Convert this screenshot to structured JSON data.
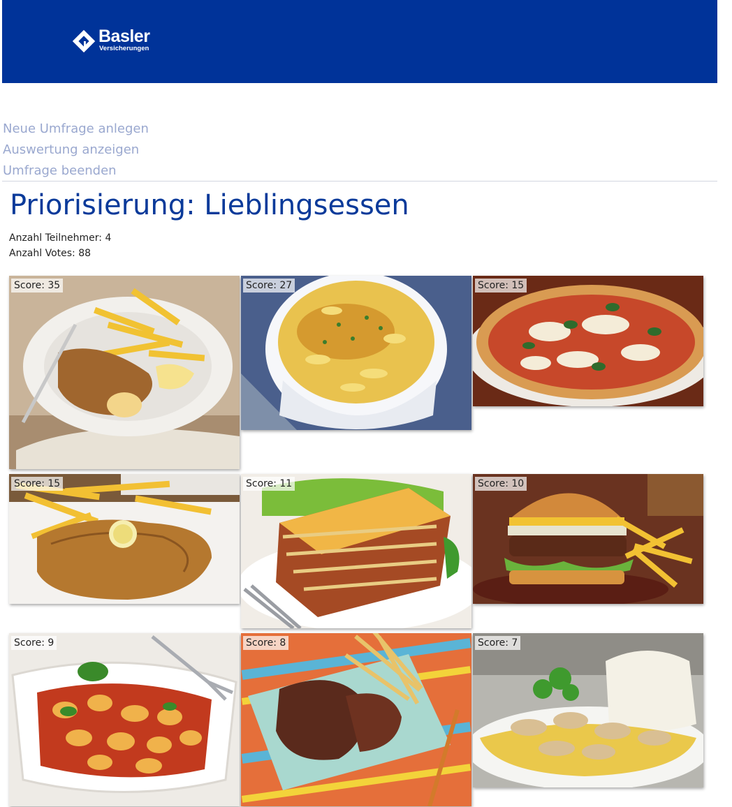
{
  "header": {
    "brand": "Basler",
    "brand_sub": "Versicherungen",
    "background_color": "#003399"
  },
  "nav": [
    {
      "label": "Neue Umfrage anlegen"
    },
    {
      "label": "Auswertung anzeigen"
    },
    {
      "label": "Umfrage beenden"
    }
  ],
  "page": {
    "title": "Priorisierung: Lieblingsessen",
    "participants": "Anzahl Teilnehmer: 4",
    "votes": "Anzahl Votes: 88"
  },
  "items": [
    {
      "score": "Score: 35",
      "image": "cordon-bleu-with-fries"
    },
    {
      "score": "Score: 27",
      "image": "macaroni-gratin"
    },
    {
      "score": "Score: 15",
      "image": "pizza-margherita"
    },
    {
      "score": "Score: 15",
      "image": "schnitzel-with-fries"
    },
    {
      "score": "Score: 11",
      "image": "lasagne"
    },
    {
      "score": "Score: 10",
      "image": "burger-with-fries"
    },
    {
      "score": "Score: 9",
      "image": "gnocchi-tomato"
    },
    {
      "score": "Score: 8",
      "image": "steak-with-fries"
    },
    {
      "score": "Score: 7",
      "image": "chicken-geschnetzeltes-rice"
    }
  ]
}
